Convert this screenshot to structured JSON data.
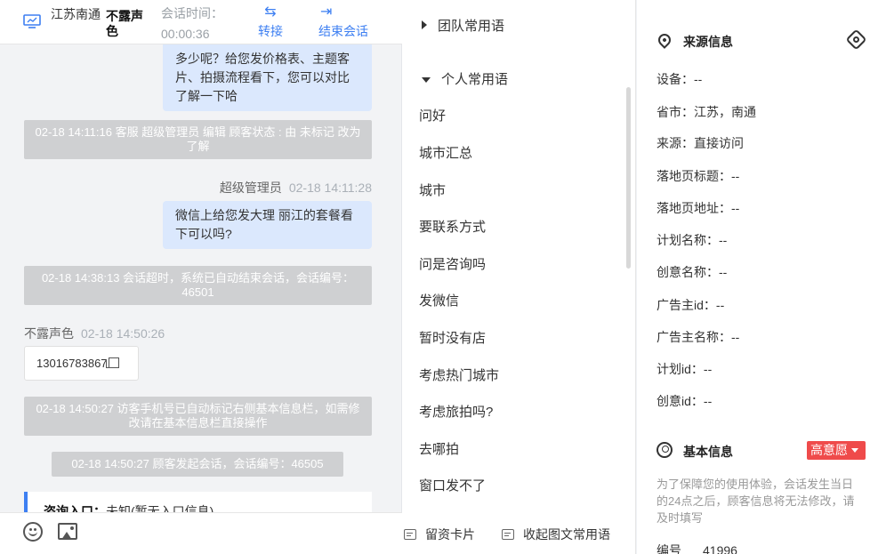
{
  "header": {
    "location": "江苏南通",
    "customer_name": "不露声色",
    "session_time_label": "会话时间：",
    "session_time": "00:00:36",
    "transfer_label": "转接",
    "end_label": "结束会话"
  },
  "messages": {
    "agent_msg_1": "多少呢？给您发价格表、主题客片、拍摄流程看下，您可以对比了解一下哈",
    "sys_1": "02-18 14:11:16 客服 超级管理员 编辑 顾客状态 : 由 未标记 改为 了解",
    "agent_name": "超级管理员",
    "agent_msg_2_time": "02-18 14:11:28",
    "agent_msg_2": "微信上给您发大理 丽江的套餐看下可以吗?",
    "sys_2": "02-18 14:38:13 会话超时，系统已自动结束会话，会话编号：46501",
    "customer_name": "不露声色",
    "customer_msg_time": "02-18 14:50:26",
    "phone": "13016783867",
    "sys_3": "02-18 14:50:27 访客手机号已自动标记右侧基本信息栏，如需修改请在基本信息栏直接操作",
    "sys_4": "02-18 14:50:27 顾客发起会话，会话编号：46505",
    "entry_label": "咨询入口：",
    "entry_value": "未知(暂无入口信息)"
  },
  "phrases": {
    "team_group": "团队常用语",
    "personal_group": "个人常用语",
    "items": [
      "问好",
      "城市汇总",
      "城市",
      "要联系方式",
      "问是咨询吗",
      "发微信",
      "暂时没有店",
      "考虑热门城市",
      "考虑旅拍吗?",
      "去哪拍",
      "窗口发不了"
    ],
    "footer_card": "留资卡片",
    "footer_collapse": "收起图文常用语"
  },
  "info": {
    "source_title": "来源信息",
    "fields": [
      {
        "label": "设备：",
        "value": "--"
      },
      {
        "label": "省市：",
        "value": "江苏，南通"
      },
      {
        "label": "来源：",
        "value": "直接访问"
      },
      {
        "label": "落地页标题：",
        "value": "--"
      },
      {
        "label": "落地页地址：",
        "value": "--"
      },
      {
        "label": "计划名称：",
        "value": "--"
      },
      {
        "label": "创意名称：",
        "value": "--"
      },
      {
        "label": "广告主id：",
        "value": "--"
      },
      {
        "label": "广告主名称：",
        "value": "--"
      },
      {
        "label": "计划id：",
        "value": "--"
      },
      {
        "label": "创意id：",
        "value": "--"
      }
    ],
    "basic_title": "基本信息",
    "intent_badge": "高意愿",
    "notice": "为了保障您的使用体验，会话发生当日的24点之后，顾客信息将无法修改，请及时填写",
    "id_label": "编号",
    "id_value": "41996"
  },
  "colors": {
    "accent": "#3d7ff2",
    "agent_bubble": "#dbe8fd",
    "system_msg": "#cfd0d2",
    "badge": "#ef4b4b"
  }
}
